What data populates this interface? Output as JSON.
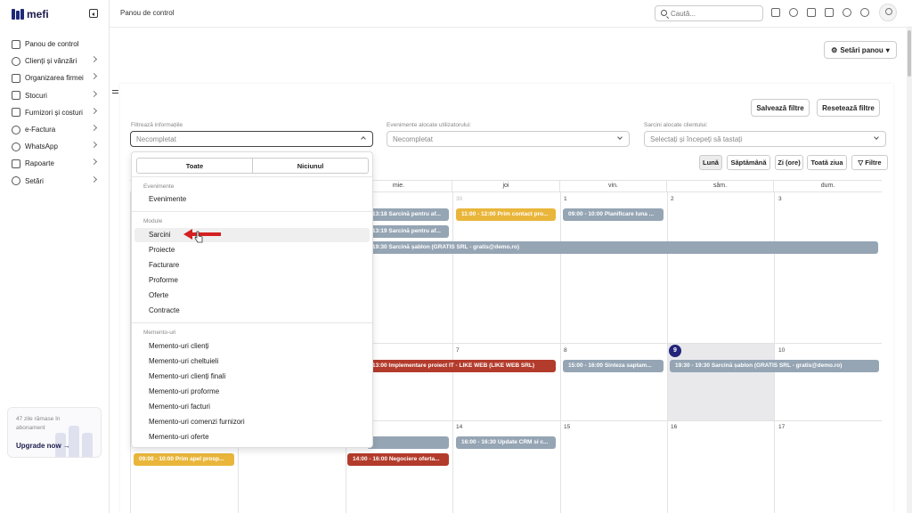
{
  "app": {
    "logo": "mefi"
  },
  "sidebar": {
    "items": [
      {
        "label": "Panou de control",
        "icon": "home-icon"
      },
      {
        "label": "Clienți și vânzări",
        "icon": "users-icon"
      },
      {
        "label": "Organizarea firmei",
        "icon": "building-icon"
      },
      {
        "label": "Stocuri",
        "icon": "box-icon"
      },
      {
        "label": "Furnizori și costuri",
        "icon": "truck-icon"
      },
      {
        "label": "e-Factura",
        "icon": "cloud-icon"
      },
      {
        "label": "WhatsApp",
        "icon": "whatsapp-icon"
      },
      {
        "label": "Rapoarte",
        "icon": "clipboard-icon"
      },
      {
        "label": "Setări",
        "icon": "gear-icon"
      }
    ],
    "upgrade": {
      "text": "47 zile rămase în abonament",
      "button": "Upgrade now"
    }
  },
  "header": {
    "title": "Panou de control",
    "search_placeholder": "Caută..."
  },
  "main": {
    "settings_button": "Setări panou",
    "save_filters": "Salvează filtre",
    "reset_filters": "Resetează filtre",
    "filters": [
      {
        "label": "Filtrează informațiile",
        "value": "Necompletat"
      },
      {
        "label": "Evenimente alocate utilizatorului:",
        "value": "Necompletat"
      },
      {
        "label": "Sarcini alocate clientului:",
        "value": "Selectați și începeți să tastați"
      }
    ],
    "views": [
      "Lună",
      "Săptămână",
      "Zi (ore)",
      "Toată ziua",
      "Filtre"
    ]
  },
  "calendar": {
    "weekdays": [
      "",
      "",
      "mie.",
      "joi",
      "vin.",
      "sâm.",
      "dum."
    ],
    "rows": [
      [
        "",
        "",
        "",
        "30",
        "1",
        "2",
        "3"
      ],
      [
        "",
        "",
        "",
        "7",
        "8",
        "9",
        "10"
      ],
      [
        "",
        "",
        "",
        "14",
        "15",
        "16",
        "17"
      ]
    ],
    "events": [
      {
        "text": "13:18 Sarcină pentru af...",
        "color": "gray"
      },
      {
        "text": "13:19 Sarcină pentru af...",
        "color": "gray"
      },
      {
        "text": "11:00 - 12:00 Prim contact pro...",
        "color": "yellow"
      },
      {
        "text": "09:00 - 10:00 Planificare luna ...",
        "color": "gray"
      },
      {
        "text": "19:30 Sarcină șablon (GRATIS SRL - gratis@demo.ro)",
        "color": "gray"
      },
      {
        "text": "13:00 Implementare proiect IT - LIKE WEB (LIKE WEB SRL)",
        "color": "red"
      },
      {
        "text": "15:00 - 16:00 Sinteza saptam...",
        "color": "gray"
      },
      {
        "text": "19:30 - 19:30 Sarcină șablon (GRATIS SRL - gratis@demo.ro)",
        "color": "gray"
      },
      {
        "text": "",
        "color": "gray"
      },
      {
        "text": "16:00 - 16:30 Update CRM si c...",
        "color": "gray"
      },
      {
        "text": "09:00 - 10:00 Prim apel prosp...",
        "color": "yellow"
      },
      {
        "text": "14:00 - 16:00 Negociere oferta...",
        "color": "red"
      }
    ]
  },
  "dropdown": {
    "all": "Toate",
    "none": "Niciunul",
    "groups": [
      {
        "title": "Evenimente",
        "items": [
          "Evenimente"
        ]
      },
      {
        "title": "Module",
        "items": [
          "Sarcini",
          "Proiecte",
          "Facturare",
          "Proforme",
          "Oferte",
          "Contracte"
        ]
      },
      {
        "title": "Memento-uri",
        "items": [
          "Memento-uri clienți",
          "Memento-uri cheltuieli",
          "Memento-uri clienți finali",
          "Memento-uri proforme",
          "Memento-uri facturi",
          "Memento-uri comenzi furnizori",
          "Memento-uri oferte"
        ]
      }
    ]
  },
  "colors": {
    "brand": "#1e2a78",
    "event_gray": "#95a5b4",
    "event_yellow": "#e9b63b",
    "event_red": "#b33b2b",
    "today": "#24247a",
    "pointer_arrow": "#d42020"
  }
}
